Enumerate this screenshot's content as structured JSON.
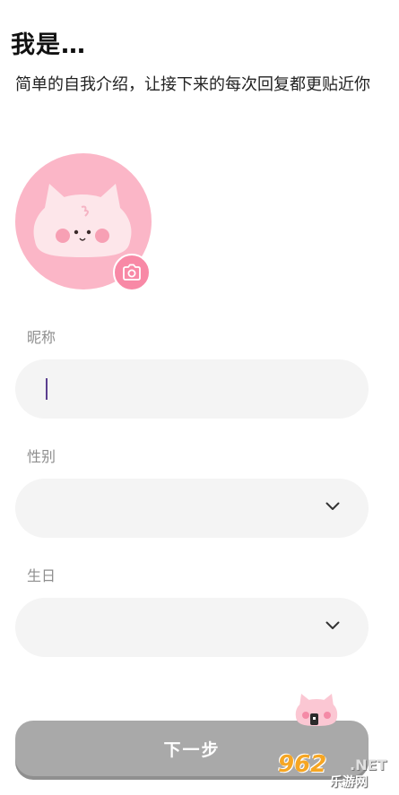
{
  "header": {
    "title": "我是…",
    "subtitle": "简单的自我介绍，让接下来的每次回复都更贴近你"
  },
  "avatar": {
    "camera_icon": "camera-icon",
    "bg_color": "#fbb6c7",
    "button_color": "#f889a6"
  },
  "fields": {
    "nickname": {
      "label": "昵称",
      "value": ""
    },
    "gender": {
      "label": "性别",
      "value": "",
      "icon": "chevron-down-icon"
    },
    "birthday": {
      "label": "生日",
      "value": "",
      "icon": "chevron-down-icon"
    }
  },
  "footer": {
    "next_label": "下一步",
    "button_color": "#a9a9a9"
  },
  "watermark": {
    "number": "962",
    "suffix": ".NET",
    "site": "乐游网"
  }
}
